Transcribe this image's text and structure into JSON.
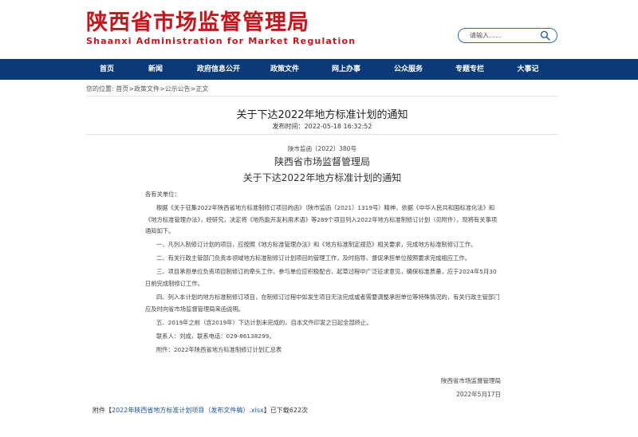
{
  "header": {
    "logo_cn": "陕西省市场监督管理局",
    "logo_en": "Shaanxi Administration for Market Regulation",
    "search_placeholder": "请输入……",
    "search_icon": "search-icon"
  },
  "nav": {
    "items": [
      "首页",
      "新闻",
      "政府信息公开",
      "政策文件",
      "网上办事",
      "公众服务",
      "专题专栏",
      "大事记"
    ]
  },
  "breadcrumb": {
    "prefix": "您的位置:",
    "items": [
      "首页",
      "政策文件",
      "公示公告",
      "正文"
    ],
    "separator": ">"
  },
  "article": {
    "title": "关于下达2022年地方标准计划的通知",
    "pubtime": "发布时间：2022-05-18 16:32:52",
    "doc_no": "陕市监函〔2022〕380号",
    "org": "陕西省市场监督管理局",
    "subtitle": "关于下达2022年地方标准计划的通知",
    "salutation": "各有关单位：",
    "paragraphs": [
      "根据《关于征集2022年陕西省地方标准制修订项目的函》（陕市监函〔2021〕1319号）精神，依据《中华人民共和国标准化法》和《地方标准管理办法》，经研究，决定将《地热能开发利用术语》等289个项目列入2022年地方标准制修订计划（见附件），现将有关事项通知如下。",
      "一、凡列入制修订计划的项目，应按照《地方标准管理办法》和《地方标准制定规范》相关要求，完成地方标准制修订工作。",
      "二、有关行政主管部门负责本领域地方标准制修订计划项目的管理工作，及时指导、督促承担单位按照要求完成相应工作。",
      "三、项目承担单位负责项目制修订的牵头工作，参与单位应积极配合，起草过程中广泛征求意见，确保标准质量，应于2024年5月30日前完成制修订工作。",
      "四、列入本计划的地方标准制修订项目，在制修订过程中如发生项目无法完成或者需要调整承担单位等特殊情况的，有关行政主管部门应及时向省市场监督管理局来函说明。",
      "五、2019年之前（含2019年）下达计划未完成的，自本文件印发之日起全部终止。",
      "联系人：刘成，联系电话：029-86138299。",
      "附件：2022年陕西省地方标准制修订计划汇总表"
    ],
    "sign_org": "陕西省市场监督管理局",
    "sign_date": "2022年5月17日"
  },
  "attachment": {
    "prefix": "附件【",
    "link": "2022年陕西省地方标准计划项目（发布文件稿）.xlsx",
    "suffix": "】已下载622次"
  }
}
